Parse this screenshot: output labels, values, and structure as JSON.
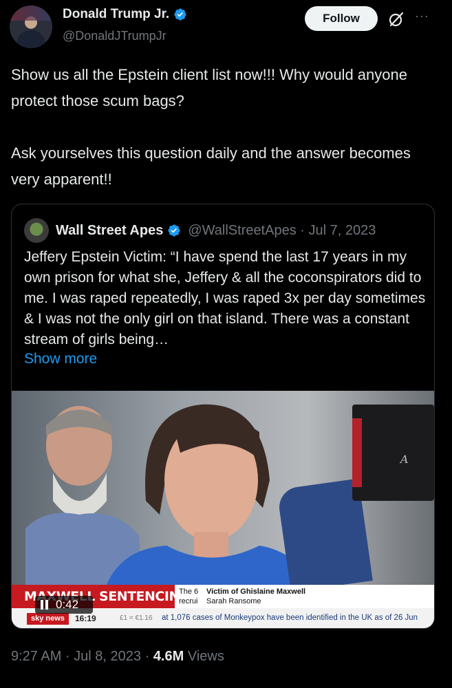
{
  "author": {
    "display_name": "Donald Trump Jr.",
    "handle": "@DonaldJTrumpJr",
    "verified_badge_color": "#1d9bf0"
  },
  "actions": {
    "follow_label": "Follow",
    "grok_icon": "grok-icon",
    "more_icon": "more-icon",
    "more_glyph": "···"
  },
  "tweet": {
    "paragraph_1": "Show us all the Epstein client list now!!! Why would anyone protect those scum bags?",
    "paragraph_2": "Ask yourselves this question daily and the answer becomes very apparent!!"
  },
  "quote": {
    "display_name": "Wall Street Apes",
    "handle_date": "@WallStreetApes · Jul 7, 2023",
    "text": "Jeffery Epstein Victim: “I have spend the last 17 years in my own prison for what she, Jeffery & all the coconspirators did to me. I was raped repeatedly, I was raped 3x per day sometimes & I was not the only girl on that island. There was a constant stream of girls being…",
    "show_more": "Show more",
    "video": {
      "headline": "MAXWELL SENTENCING",
      "caption_left_1": "The 6",
      "caption_right_1": "Victim of Ghislaine Maxwell",
      "caption_left_2": "recrui",
      "caption_right_2": "Sarah Ransome",
      "ticker_logo": "sky news",
      "ticker_time": "16:19",
      "ticker_fx": "£1 = €1.16",
      "ticker_news": "at 1,076 cases of Monkeypox have been identified in the UK as of 26 Jun",
      "camera_label": "A",
      "duration": "0:42"
    }
  },
  "meta": {
    "time": "9:27 AM",
    "date": "Jul 8, 2023",
    "views_count": "4.6M",
    "views_label": "Views"
  },
  "colors": {
    "background": "#000000",
    "text": "#e7e9ea",
    "secondary": "#71767b",
    "link": "#1d9bf0",
    "border": "#2f3336"
  }
}
